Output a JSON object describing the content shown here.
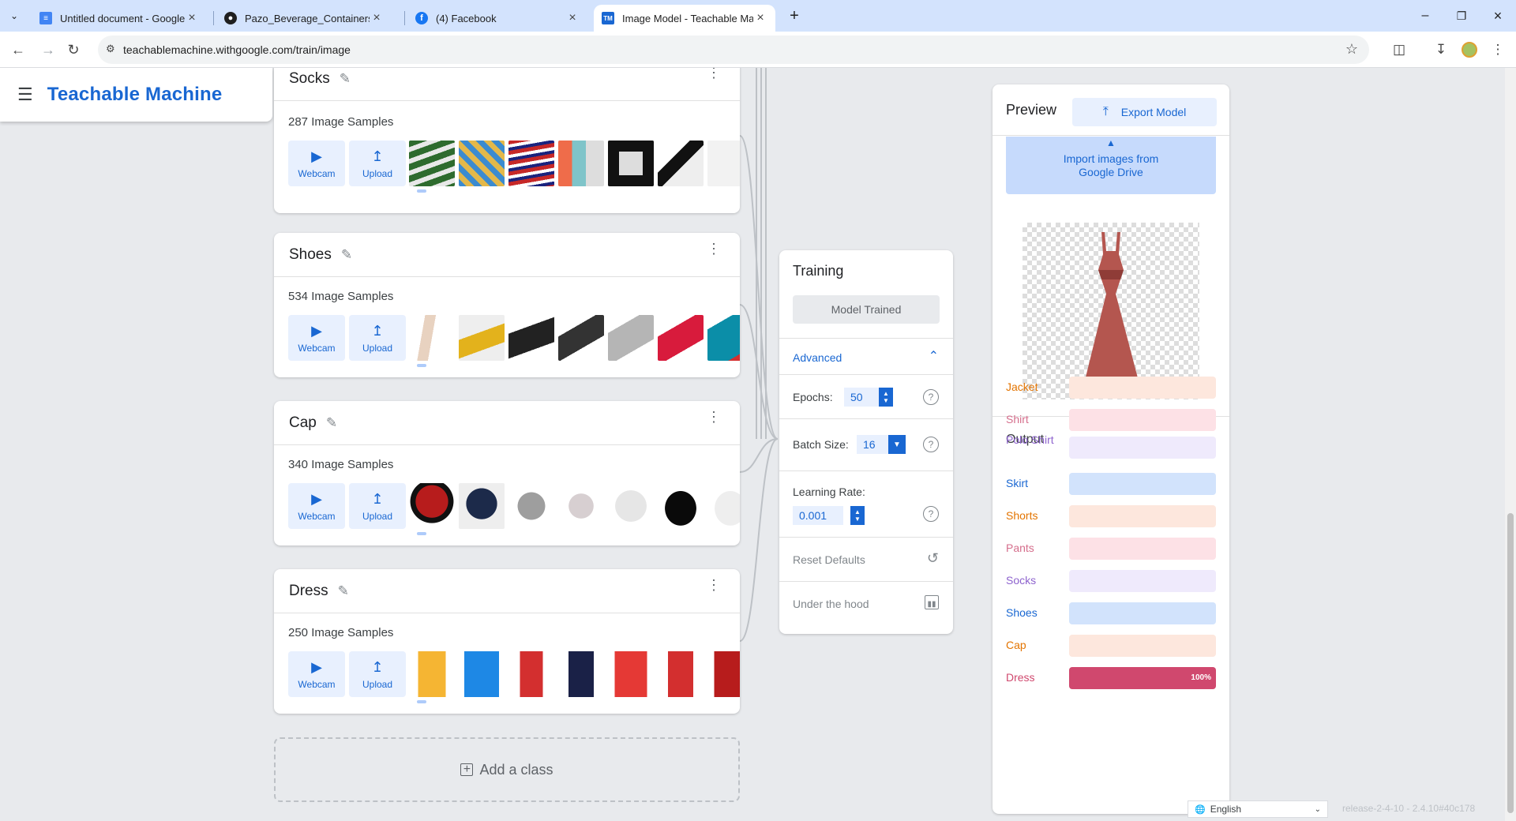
{
  "browser": {
    "tabs": [
      {
        "title": "Untitled document - Google Do",
        "icon": "google-docs-icon"
      },
      {
        "title": "Pazo_Beverage_Containers_Clas",
        "icon": "github-icon"
      },
      {
        "title": "(4) Facebook",
        "icon": "facebook-icon"
      },
      {
        "title": "Image Model - Teachable Mach",
        "icon": "teachable-machine-icon",
        "active": true
      }
    ],
    "url": "teachablemachine.withgoogle.com/train/image"
  },
  "header": {
    "title": "Teachable Machine"
  },
  "classes": [
    {
      "name": "Socks",
      "samples": "287 Image Samples"
    },
    {
      "name": "Shoes",
      "samples": "534 Image Samples"
    },
    {
      "name": "Cap",
      "samples": "340 Image Samples"
    },
    {
      "name": "Dress",
      "samples": "250 Image Samples"
    }
  ],
  "buttons": {
    "webcam": "Webcam",
    "upload": "Upload"
  },
  "add_class": "Add a class",
  "training": {
    "title": "Training",
    "status_button": "Model Trained",
    "advanced": "Advanced",
    "epochs_label": "Epochs:",
    "epochs": "50",
    "batch_label": "Batch Size:",
    "batch": "16",
    "lr_label": "Learning Rate:",
    "lr": "0.001",
    "reset": "Reset Defaults",
    "under_hood": "Under the hood"
  },
  "preview": {
    "title": "Preview",
    "export": "Export Model",
    "import_line1": "Import images from",
    "import_line2": "Google Drive",
    "output_title": "Output",
    "outputs": [
      {
        "label": "Jacket",
        "color": "#e37400",
        "bg": "#fde7dd",
        "fill": 0
      },
      {
        "label": "Shirt",
        "color": "#d56e8c",
        "bg": "#fde1e6",
        "fill": 0
      },
      {
        "label": "Polo Shirt",
        "color": "#8e63ce",
        "bg": "#efeafc",
        "fill": 0
      },
      {
        "label": "Skirt",
        "color": "#1967d2",
        "bg": "#d2e3fc",
        "fill": 0
      },
      {
        "label": "Shorts",
        "color": "#e37400",
        "bg": "#fde7dd",
        "fill": 0
      },
      {
        "label": "Pants",
        "color": "#d56e8c",
        "bg": "#fde1e6",
        "fill": 0
      },
      {
        "label": "Socks",
        "color": "#8e63ce",
        "bg": "#efeafc",
        "fill": 0
      },
      {
        "label": "Shoes",
        "color": "#1967d2",
        "bg": "#d2e3fc",
        "fill": 0
      },
      {
        "label": "Cap",
        "color": "#e37400",
        "bg": "#fde7dd",
        "fill": 0
      },
      {
        "label": "Dress",
        "color": "#d0486e",
        "bg": "#fde1e6",
        "fill": 1.0,
        "pct": "100%"
      }
    ]
  },
  "footer": {
    "language": "English",
    "version": "release-2-4-10 - 2.4.10#40c178"
  }
}
